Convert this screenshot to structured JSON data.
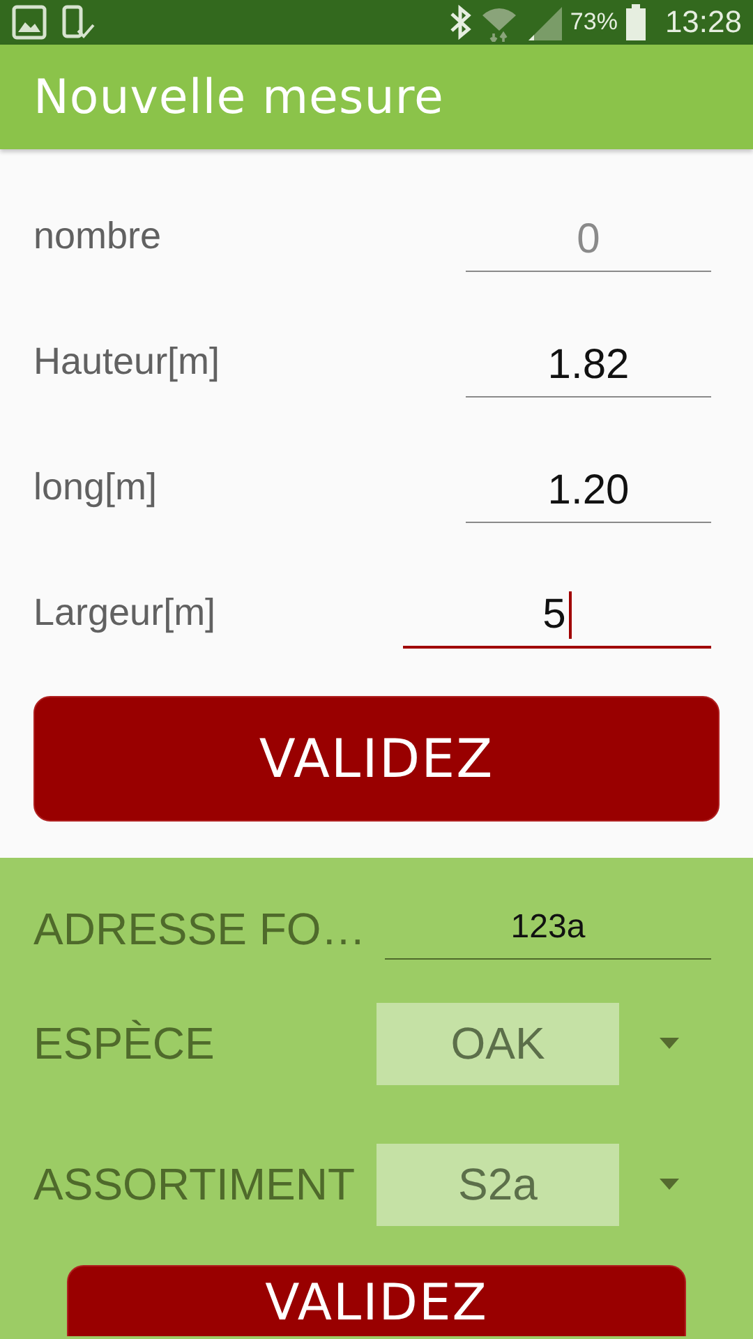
{
  "status_bar": {
    "battery_text": "73%",
    "time": "13:28"
  },
  "title": "Nouvelle mesure",
  "measure_fields": [
    {
      "label": "nombre",
      "placeholder": "0",
      "focused": false
    },
    {
      "label": "Hauteur[m]",
      "value": "1.82",
      "focused": false
    },
    {
      "label": "long[m]",
      "value": "1.20",
      "focused": false
    },
    {
      "label": "Largeur[m]",
      "value": "5",
      "focused": true
    }
  ],
  "measure_button": "VALIDEZ",
  "details": {
    "address": {
      "label": "ADRESSE FO…",
      "value": "123a"
    },
    "dropdowns": [
      {
        "label": "ESPÈCE",
        "value": "OAK"
      },
      {
        "label": "ASSORTIMENT",
        "value": "S2a"
      }
    ],
    "button": "VALIDEZ"
  }
}
